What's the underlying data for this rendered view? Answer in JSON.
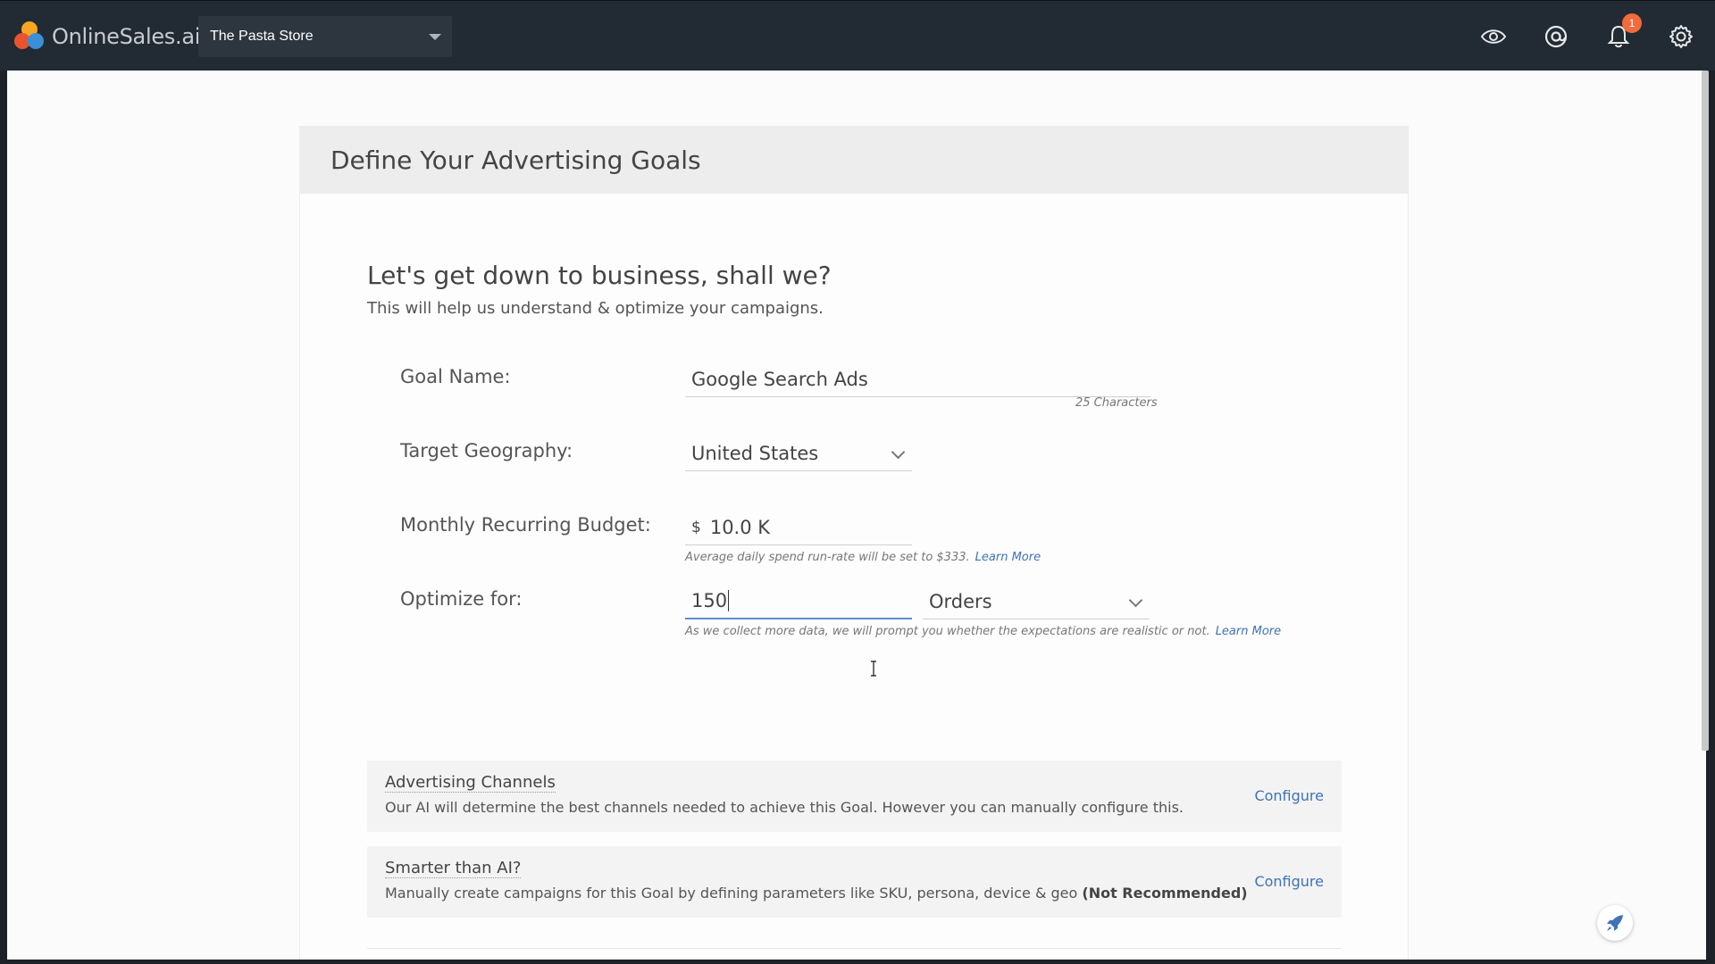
{
  "app": {
    "name": "OnlineSales.ai",
    "store": "The Pasta Store",
    "notification_count": "1"
  },
  "header": {
    "icons": [
      "eye-icon",
      "at-sign-icon",
      "bell-icon",
      "gear-icon"
    ]
  },
  "card": {
    "title": "Define Your Advertising Goals",
    "intro_title": "Let's get down to business, shall we?",
    "intro_sub": "This will help us understand & optimize your campaigns."
  },
  "form": {
    "goal_name_label": "Goal Name:",
    "goal_name_value": "Google Search Ads",
    "goal_name_count": "25 Characters",
    "geo_label": "Target Geography:",
    "geo_value": "United States",
    "budget_label": "Monthly Recurring Budget:",
    "budget_currency": "$",
    "budget_value": "10.0 K",
    "budget_hint": "Average daily spend run-rate will be set to $333.",
    "budget_learn_more": "Learn More",
    "optimize_label": "Optimize for:",
    "optimize_value": "150",
    "optimize_metric": "Orders",
    "optimize_hint": "As we collect more data, we will prompt you whether the expectations are realistic or not.",
    "optimize_learn_more": "Learn More"
  },
  "options": [
    {
      "title": "Advertising Channels",
      "desc": "Our AI will determine the best channels needed to achieve this Goal. However you can manually configure this.",
      "action": "Configure"
    },
    {
      "title": "Smarter than AI?",
      "desc": "Manually create campaigns for this Goal by defining parameters like SKU, persona, device & geo",
      "desc_bold": "(Not Recommended)",
      "action": "Configure"
    }
  ],
  "colors": {
    "topbar": "#222a33",
    "accent": "#3f72b7",
    "badge": "#f26b3a"
  }
}
